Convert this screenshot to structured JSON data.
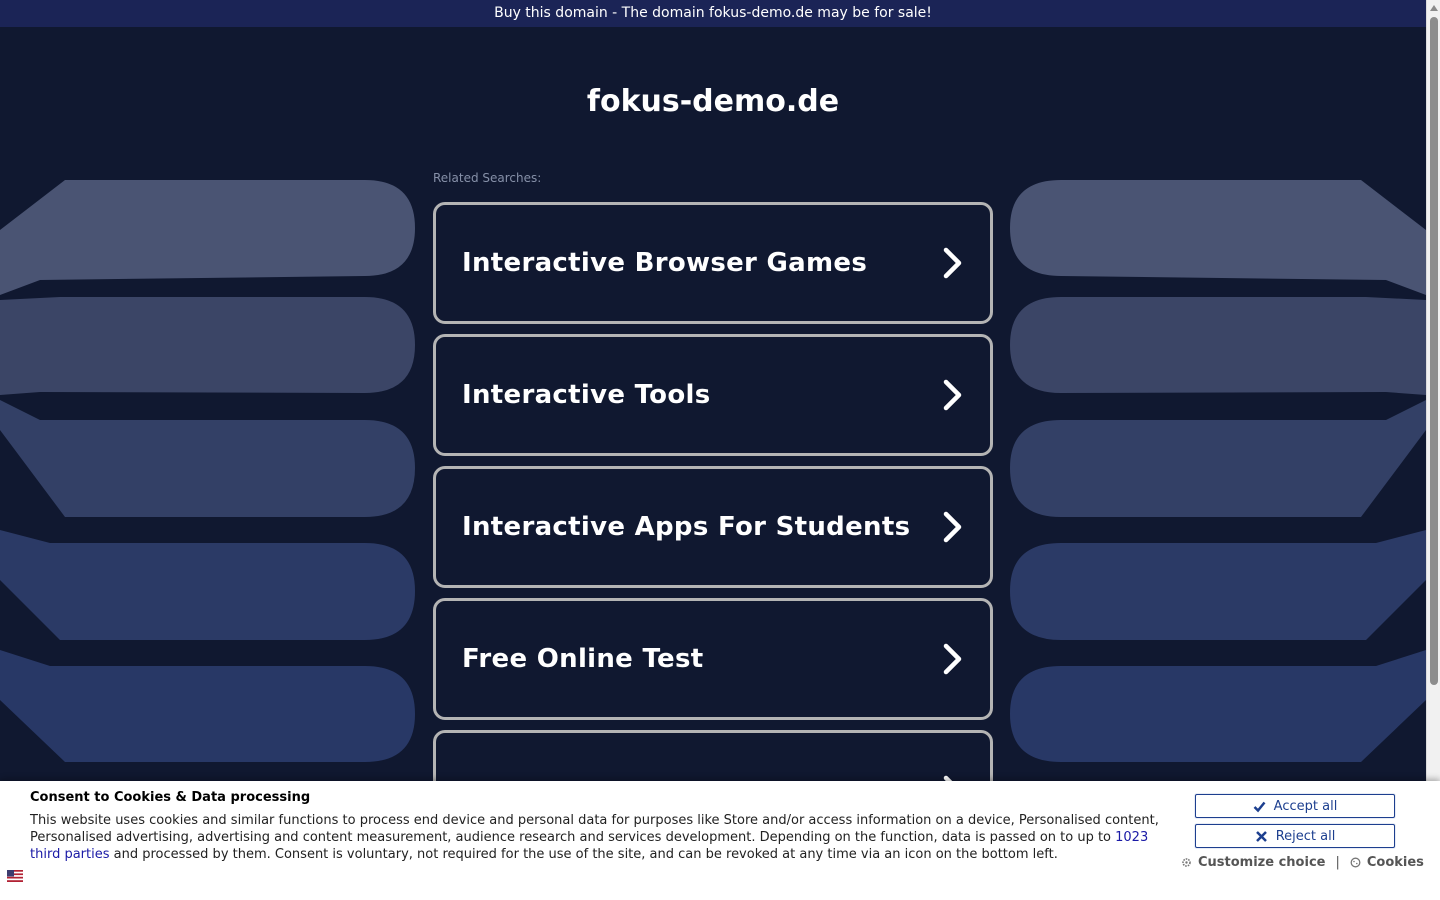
{
  "banner": {
    "text": "Buy this domain - The domain fokus-demo.de may be for sale!"
  },
  "site": {
    "domain": "fokus-demo.de",
    "related_label": "Related Searches:"
  },
  "searches": [
    {
      "label": "Interactive Browser Games",
      "icon": "chevron-right-icon"
    },
    {
      "label": "Interactive Tools",
      "icon": "chevron-right-icon"
    },
    {
      "label": "Interactive Apps For Students",
      "icon": "chevron-right-icon"
    },
    {
      "label": "Free Online Test",
      "icon": "chevron-right-icon"
    },
    {
      "label": "",
      "icon": "chevron-right-icon"
    }
  ],
  "consent": {
    "title": "Consent to Cookies & Data processing",
    "text_before_link": "This website uses cookies and similar functions to process end device and personal data for purposes like Store and/or access information on a device, Personalised content, Personalised advertising, advertising and content measurement, audience research and services development. Depending on the function, data is passed on to up to ",
    "link_text": "1023 third parties",
    "text_after_link": " and processed by them. Consent is voluntary, not required for the use of the site, and can be revoked at any time via an icon on the bottom left.",
    "accept_label": "Accept all",
    "reject_label": "Reject all",
    "customize_label": "Customize choice",
    "separator": "|",
    "cookies_label": "Cookies"
  },
  "colors": {
    "background": "#101830",
    "banner": "#1b2456",
    "button_border": "#b4b4b4",
    "consent_accent": "#1d3f8f"
  }
}
